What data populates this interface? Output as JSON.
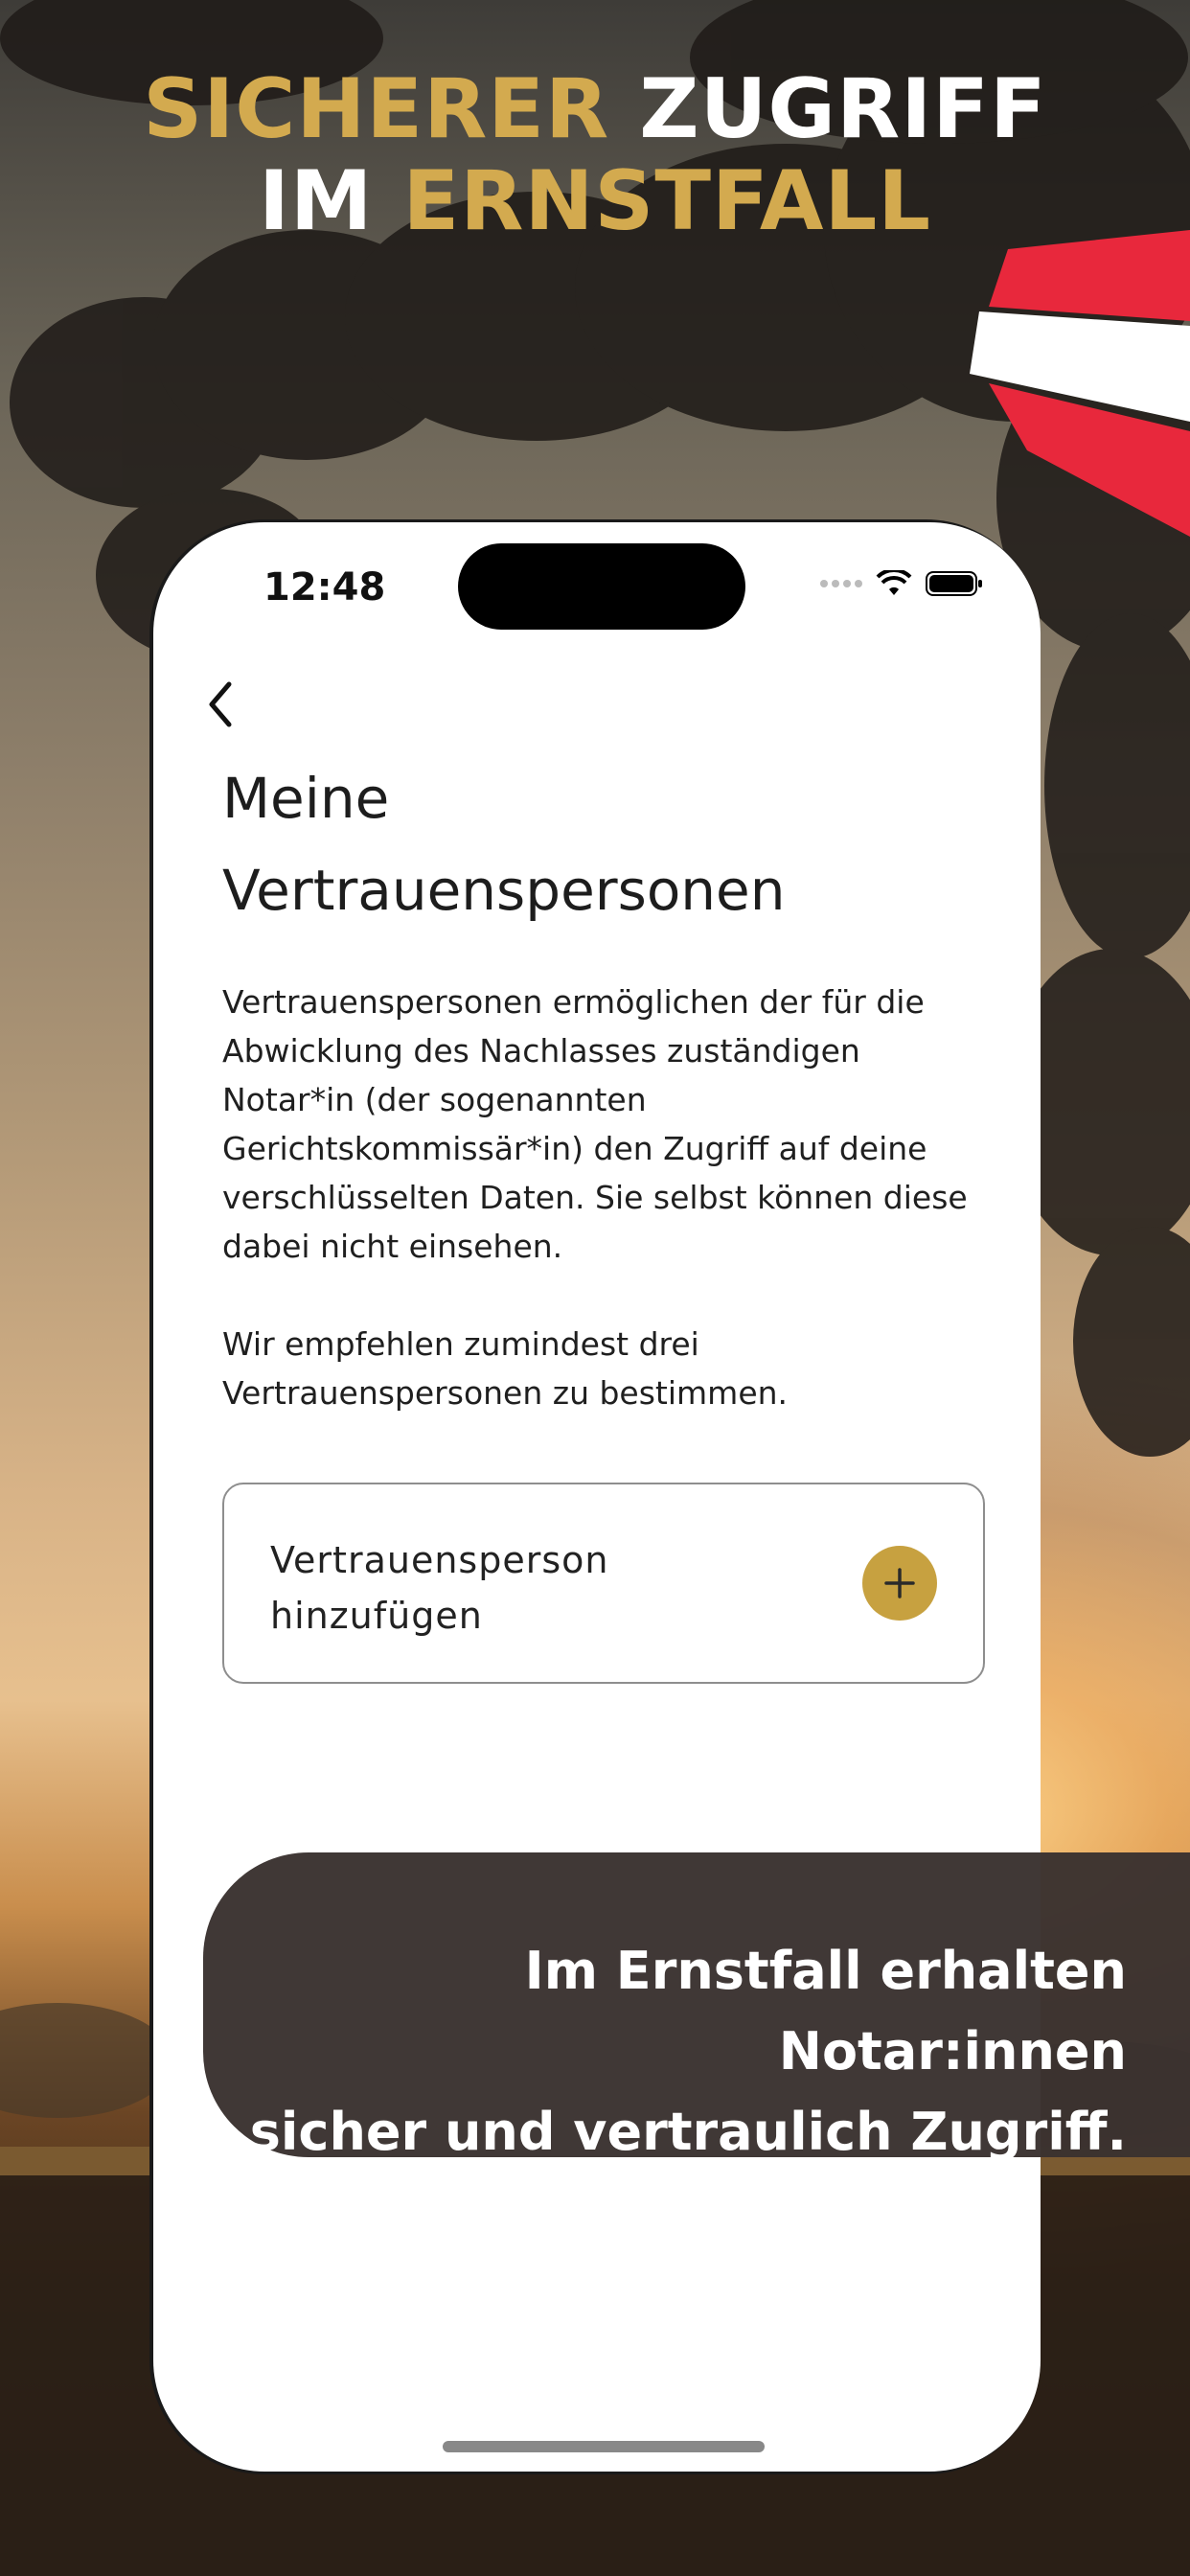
{
  "headline": {
    "line1_gold": "SICHERER",
    "line1_white": " ZUGRIFF",
    "line2_white": "IM ",
    "line2_gold": "ERNSTFALL"
  },
  "status_bar": {
    "time": "12:48"
  },
  "page": {
    "title": "Meine\nVertrauenspersonen",
    "description_1": "Vertrauenspersonen ermöglichen der für die Abwicklung des Nachlasses zuständigen Notar*in (der sogenannten Gerichtskommissär*in) den Zugriff auf deine verschlüsselten Daten. Sie selbst können diese dabei nicht einsehen.",
    "description_2": "Wir empfehlen zumindest drei Vertrauenspersonen zu bestimmen."
  },
  "add_card": {
    "label": "Vertrauensperson\nhinzufügen"
  },
  "banner": {
    "text": "Im Ernstfall erhalten Notar:innen\nsicher und vertraulich Zugriff."
  },
  "colors": {
    "accent_gold": "#d3aa4f",
    "button_gold": "#c7a140",
    "banner_bg": "#3a3230",
    "flag_red": "#e8283c"
  },
  "icons": [
    "back-chevron-icon",
    "plus-icon",
    "wifi-icon",
    "battery-icon",
    "signal-icon"
  ]
}
